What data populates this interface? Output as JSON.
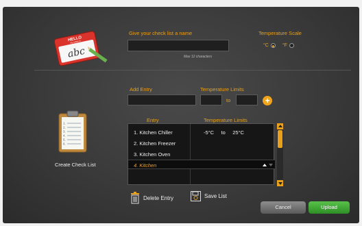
{
  "name_section": {
    "label": "Give your check list a name",
    "input_value": "",
    "max_note": "Max 12 characters"
  },
  "scale_section": {
    "label": "Temperature Scale",
    "celsius": "°C",
    "fahrenheit": "°F",
    "selected": "°C"
  },
  "entry_section": {
    "add_label": "Add Entry",
    "limits_label": "Temperature Limits",
    "to_label": "to",
    "plus": "+"
  },
  "table": {
    "headers": [
      "Entry",
      "Temperature Limits"
    ],
    "rows": [
      {
        "name": "1. Kitchen Chiller",
        "low": "-5°C",
        "to": "to",
        "high": "25°C"
      },
      {
        "name": "2. Kitchen Freezer"
      },
      {
        "name": "3. Kitchen Oven"
      },
      {
        "name": "4. Kitchen",
        "selected": true
      }
    ]
  },
  "actions": {
    "delete_label": "Delete Entry",
    "save_label": "Save List"
  },
  "sidebar": {
    "badge_hello": "HELLO",
    "badge_subtitle": "my name is",
    "badge_text": "abc",
    "caption": "Create Check List"
  },
  "buttons": {
    "cancel": "Cancel",
    "upload": "Upload"
  },
  "colors": {
    "accent": "#e9a11b",
    "upload": "#3aa631",
    "panel": "#3a3a3a"
  }
}
